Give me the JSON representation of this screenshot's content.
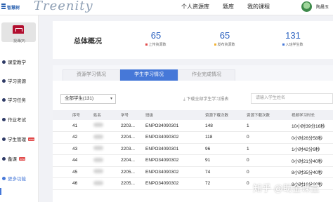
{
  "header": {
    "brand_cn": "智慧树",
    "brand_script": "Treenity",
    "nav": [
      "个人资源库",
      "题库",
      "我的课程"
    ],
    "user_name": "陶晨玉"
  },
  "sidebar": {
    "name_tag": "授课(P)",
    "items": [
      {
        "label": "课堂教学",
        "badge": ""
      },
      {
        "label": "学习资源",
        "badge": ""
      },
      {
        "label": "学习任务",
        "badge": ""
      },
      {
        "label": "作业考试",
        "badge": ""
      },
      {
        "label": "学生管理",
        "badge": "new"
      },
      {
        "label": "备课",
        "badge": "new"
      },
      {
        "label": "更多功能",
        "badge": ""
      }
    ]
  },
  "overview": {
    "title": "总体概况",
    "stats": [
      {
        "value": "65",
        "label": "上传资源数",
        "color": "#e14a4a"
      },
      {
        "value": "65",
        "label": "发布资源数",
        "color": "#f2b233"
      },
      {
        "value": "131",
        "label": "入班学生数",
        "color": "#4678d8"
      }
    ]
  },
  "tabs": [
    "资源学习情况",
    "学生学习情况",
    "作业完成情况"
  ],
  "filter": {
    "selected": "全部学生(131)",
    "download_label": "下载全部学生学习报表",
    "search_placeholder": "请输入学生姓名"
  },
  "table": {
    "columns": [
      "序号",
      "姓名",
      "学号",
      "班级",
      "资源下载次数",
      "资源下载次数",
      "视频学习时长"
    ],
    "rows": [
      {
        "idx": "41",
        "id": "2203...",
        "class": "ENPO34090301",
        "views": "148",
        "downloads": "1",
        "time": "10小时39分16秒"
      },
      {
        "idx": "42",
        "id": "2204...",
        "class": "ENPO34090302",
        "views": "118",
        "downloads": "0",
        "time": "0小时26分58秒"
      },
      {
        "idx": "43",
        "id": "2203...",
        "class": "ENPO34090301",
        "views": "96",
        "downloads": "1",
        "time": "1小时42分9秒"
      },
      {
        "idx": "44",
        "id": "2204...",
        "class": "ENPO34090302",
        "views": "91",
        "downloads": "0",
        "time": "0小时21分40秒"
      },
      {
        "idx": "45",
        "id": "2205...",
        "class": "ENPO34090302",
        "views": "74",
        "downloads": "0",
        "time": "8小时35分40秒"
      },
      {
        "idx": "46",
        "id": "2205...",
        "class": "ENPO34090302",
        "views": "72",
        "downloads": "0",
        "time": "8小时16分20秒"
      }
    ]
  },
  "watermark": "知乎 @助金课堂"
}
